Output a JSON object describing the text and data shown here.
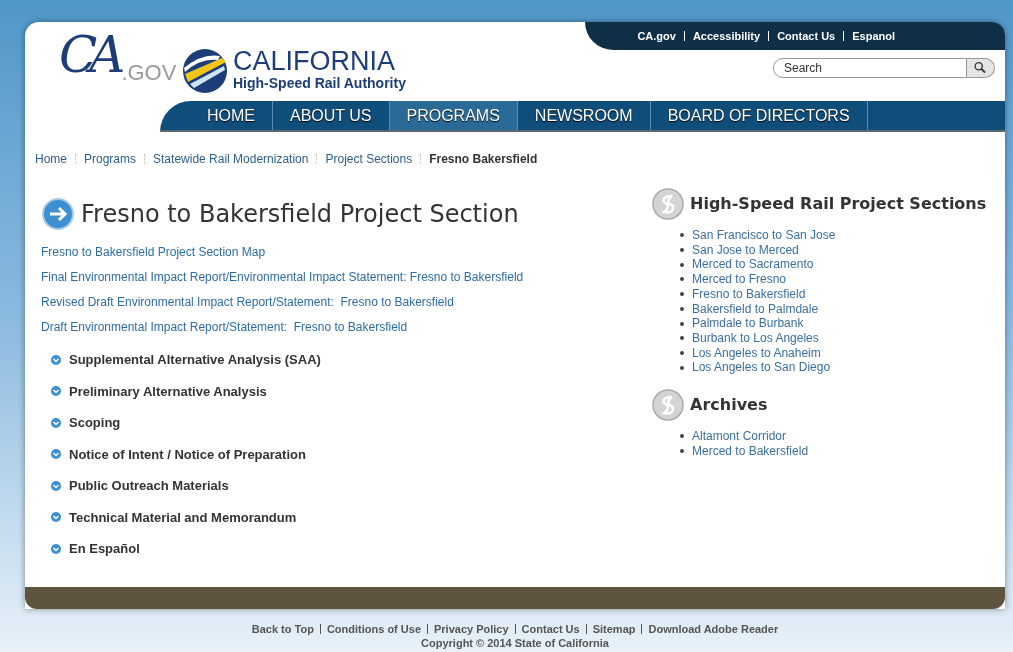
{
  "utility_links": [
    "CA.gov",
    "Accessibility",
    "Contact Us",
    "Espanol"
  ],
  "logo": {
    "ca_gov": "CA",
    "ca_gov_suffix": ".GOV",
    "title": "CALIFORNIA",
    "subtitle": "High-Speed Rail Authority"
  },
  "search": {
    "placeholder": "Search"
  },
  "nav": [
    {
      "label": "HOME",
      "selected": false
    },
    {
      "label": "ABOUT US",
      "selected": false
    },
    {
      "label": "PROGRAMS",
      "selected": true
    },
    {
      "label": "NEWSROOM",
      "selected": false
    },
    {
      "label": "BOARD OF DIRECTORS",
      "selected": false
    }
  ],
  "breadcrumb": [
    {
      "label": "Home",
      "current": false
    },
    {
      "label": "Programs",
      "current": false
    },
    {
      "label": "Statewide Rail Modernization",
      "current": false
    },
    {
      "label": "Project Sections",
      "current": false
    },
    {
      "label": "Fresno Bakersfield",
      "current": true
    }
  ],
  "page_title": "Fresno to Bakersfield Project Section",
  "document_links": [
    "Fresno to Bakersfield Project Section Map",
    "Final Environmental Impact Report/Environmental Impact Statement: Fresno to Bakersfield",
    "Revised Draft Environmental Impact Report/Statement:  Fresno to Bakersfield",
    "Draft Environmental Impact Report/Statement:  Fresno to Bakersfield"
  ],
  "sections": [
    {
      "label": "Supplemental Alternative Analysis (SAA)",
      "expanded": false
    },
    {
      "label": "Preliminary Alternative Analysis",
      "expanded": false
    },
    {
      "label": "Scoping",
      "expanded": false
    },
    {
      "label": "Notice of Intent / Notice of Preparation",
      "expanded": false
    },
    {
      "label": "Public Outreach Materials",
      "expanded": false
    },
    {
      "label": "Technical Material and Memorandum",
      "expanded": false
    },
    {
      "label": "En Español",
      "expanded": false
    }
  ],
  "sidebar": [
    {
      "title": "High-Speed Rail Project Sections",
      "items": [
        "San Francisco to San Jose",
        "San Jose to Merced",
        "Merced to Sacramento",
        "Merced to Fresno",
        "Fresno to Bakersfield",
        "Bakersfield to Palmdale",
        "Palmdale to Burbank",
        "Burbank to Los Angeles",
        "Los Angeles to Anaheim",
        "Los Angeles to San Diego"
      ]
    },
    {
      "title": "Archives",
      "items": [
        "Altamont Corridor",
        "Merced to Bakersfield"
      ]
    }
  ],
  "footer_links": [
    "Back to Top",
    "Conditions of Use",
    "Privacy Policy",
    "Contact Us",
    "Sitemap",
    "Download Adobe Reader"
  ],
  "copyright": "Copyright © 2014 State of California"
}
